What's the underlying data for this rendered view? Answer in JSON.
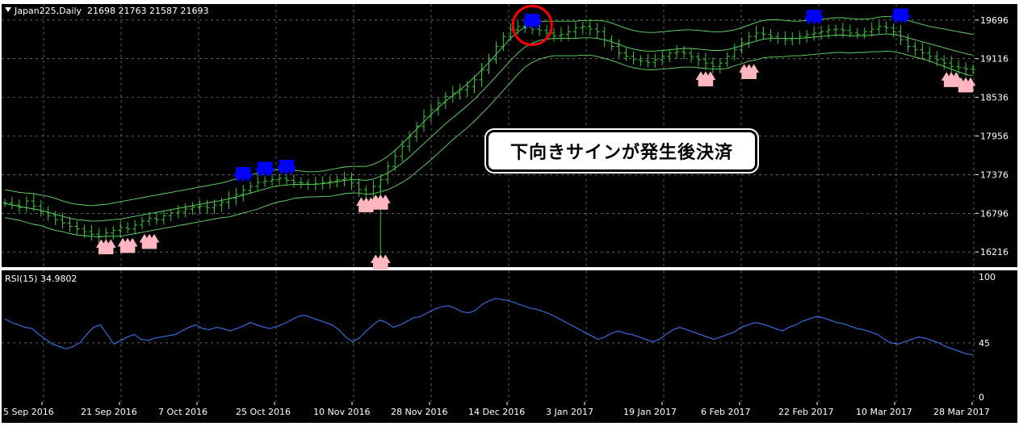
{
  "symbol_header": {
    "symbol": "Japan225,Daily",
    "ohlc": "21698 21763 21587 21693"
  },
  "rsi_header": {
    "label": "RSI(15) 34.9802"
  },
  "callout": {
    "text": "下向きサインが発生後決済"
  },
  "colors": {
    "background": "#000000",
    "grid": "#9aa3a8",
    "candles": "#33cc33",
    "bands": "#66dd66",
    "rsi_line": "#3b7bff",
    "sell_arrow": "#0000ff",
    "buy_arrow": "#ffb6c1",
    "highlight_circle": "#ff0000",
    "text": "#ffffff"
  },
  "chart_data": [
    {
      "type": "line",
      "series_kind": "ohlc-bars-with-bands",
      "price_ticks": [
        "19696",
        "19116",
        "18536",
        "17956",
        "17376",
        "16796",
        "16216"
      ],
      "x_tick_labels": [
        "5 Sep 2016",
        "21 Sep 2016",
        "7 Oct 2016",
        "25 Oct 2016",
        "10 Nov 2016",
        "28 Nov 2016",
        "14 Dec 2016",
        "3 Jan 2017",
        "19 Jan 2017",
        "6 Feb 2017",
        "22 Feb 2017",
        "10 Mar 2017",
        "28 Mar 2017"
      ],
      "ylim": [
        16000,
        19900
      ],
      "close": [
        16950,
        16920,
        16880,
        16980,
        16900,
        16820,
        16760,
        16700,
        16650,
        16600,
        16560,
        16520,
        16480,
        16450,
        16500,
        16540,
        16580,
        16560,
        16620,
        16680,
        16720,
        16700,
        16760,
        16800,
        16820,
        16860,
        16890,
        16900,
        16880,
        16920,
        16960,
        17020,
        17080,
        17140,
        17200,
        17260,
        17280,
        17300,
        17320,
        17290,
        17260,
        17250,
        17230,
        17240,
        17260,
        17280,
        17300,
        17320,
        17250,
        17150,
        17000,
        17200,
        17300,
        17500,
        17650,
        17800,
        17950,
        18100,
        18250,
        18350,
        18450,
        18550,
        18600,
        18650,
        18700,
        18800,
        18950,
        19100,
        19300,
        19450,
        19550,
        19600,
        19580,
        19560,
        19540,
        19500,
        19460,
        19480,
        19520,
        19580,
        19600,
        19560,
        19520,
        19400,
        19300,
        19200,
        19150,
        19100,
        19080,
        19060,
        19100,
        19150,
        19200,
        19220,
        19200,
        19150,
        19100,
        19050,
        19000,
        19050,
        19150,
        19250,
        19350,
        19450,
        19500,
        19480,
        19450,
        19420,
        19400,
        19420,
        19450,
        19480,
        19500,
        19520,
        19550,
        19560,
        19540,
        19500,
        19480,
        19520,
        19560,
        19600,
        19580,
        19520,
        19400,
        19300,
        19250,
        19200,
        19150,
        19100,
        19050,
        19000,
        18980,
        18960,
        18950
      ],
      "upper_band": [
        17150,
        17130,
        17110,
        17100,
        17090,
        17070,
        17050,
        17020,
        16980,
        16950,
        16930,
        16920,
        16910,
        16920,
        16930,
        16950,
        16970,
        16990,
        17010,
        17030,
        17050,
        17070,
        17090,
        17110,
        17130,
        17150,
        17170,
        17190,
        17210,
        17230,
        17250,
        17280,
        17310,
        17340,
        17370,
        17400,
        17420,
        17440,
        17450,
        17450,
        17440,
        17430,
        17420,
        17420,
        17430,
        17450,
        17470,
        17490,
        17500,
        17500,
        17500,
        17530,
        17580,
        17650,
        17740,
        17840,
        17950,
        18060,
        18170,
        18280,
        18380,
        18480,
        18560,
        18650,
        18740,
        18840,
        18950,
        19060,
        19180,
        19300,
        19420,
        19520,
        19590,
        19640,
        19670,
        19680,
        19680,
        19680,
        19680,
        19680,
        19690,
        19690,
        19690,
        19680,
        19650,
        19610,
        19570,
        19540,
        19520,
        19510,
        19510,
        19520,
        19530,
        19540,
        19550,
        19550,
        19540,
        19530,
        19520,
        19520,
        19530,
        19550,
        19580,
        19620,
        19660,
        19690,
        19700,
        19700,
        19690,
        19680,
        19680,
        19690,
        19700,
        19710,
        19720,
        19730,
        19730,
        19720,
        19710,
        19710,
        19720,
        19740,
        19750,
        19740,
        19720,
        19690,
        19660,
        19630,
        19600,
        19580,
        19560,
        19540,
        19520,
        19500,
        19480
      ],
      "middle_band": [
        16940,
        16920,
        16900,
        16880,
        16860,
        16840,
        16810,
        16780,
        16750,
        16720,
        16700,
        16690,
        16680,
        16680,
        16690,
        16700,
        16710,
        16730,
        16750,
        16770,
        16790,
        16810,
        16830,
        16850,
        16870,
        16890,
        16910,
        16930,
        16950,
        16970,
        16990,
        17010,
        17040,
        17070,
        17100,
        17130,
        17160,
        17190,
        17210,
        17220,
        17230,
        17230,
        17230,
        17230,
        17240,
        17250,
        17270,
        17290,
        17300,
        17300,
        17290,
        17310,
        17350,
        17400,
        17470,
        17550,
        17640,
        17740,
        17840,
        17940,
        18040,
        18140,
        18230,
        18320,
        18410,
        18510,
        18620,
        18730,
        18850,
        18970,
        19090,
        19200,
        19290,
        19350,
        19390,
        19410,
        19420,
        19420,
        19420,
        19420,
        19430,
        19430,
        19420,
        19400,
        19370,
        19330,
        19290,
        19260,
        19240,
        19230,
        19230,
        19240,
        19250,
        19260,
        19270,
        19270,
        19260,
        19250,
        19240,
        19240,
        19250,
        19280,
        19310,
        19350,
        19380,
        19410,
        19420,
        19420,
        19420,
        19420,
        19420,
        19430,
        19440,
        19450,
        19460,
        19470,
        19470,
        19460,
        19460,
        19460,
        19470,
        19480,
        19490,
        19480,
        19460,
        19430,
        19400,
        19370,
        19340,
        19310,
        19280,
        19250,
        19220,
        19190,
        19170
      ],
      "lower_band": [
        16730,
        16710,
        16690,
        16660,
        16630,
        16610,
        16570,
        16540,
        16520,
        16490,
        16470,
        16460,
        16450,
        16440,
        16450,
        16450,
        16450,
        16470,
        16490,
        16510,
        16530,
        16550,
        16570,
        16590,
        16610,
        16630,
        16650,
        16670,
        16690,
        16710,
        16730,
        16740,
        16770,
        16800,
        16830,
        16860,
        16900,
        16940,
        16970,
        16990,
        17020,
        17030,
        17040,
        17040,
        17050,
        17050,
        17070,
        17090,
        17100,
        17100,
        17080,
        17090,
        17120,
        17150,
        17200,
        17260,
        17330,
        17420,
        17510,
        17600,
        17700,
        17800,
        17900,
        17990,
        18080,
        18180,
        18290,
        18400,
        18520,
        18640,
        18760,
        18880,
        18990,
        19060,
        19110,
        19140,
        19160,
        19160,
        19160,
        19160,
        19170,
        19170,
        19150,
        19120,
        19090,
        19050,
        19010,
        18980,
        18960,
        18950,
        18950,
        18960,
        18970,
        18980,
        18990,
        18990,
        18980,
        18970,
        18960,
        18960,
        18970,
        19010,
        19040,
        19080,
        19100,
        19130,
        19140,
        19140,
        19150,
        19160,
        19160,
        19170,
        19180,
        19190,
        19200,
        19210,
        19210,
        19200,
        19210,
        19210,
        19220,
        19220,
        19230,
        19220,
        19200,
        19170,
        19140,
        19110,
        19080,
        19040,
        19000,
        18960,
        18920,
        18880,
        18860
      ],
      "sell_arrows_index": [
        33,
        36,
        39,
        73,
        112,
        124
      ],
      "buy_arrows_index": [
        14,
        17,
        20,
        50,
        52,
        97,
        103,
        131,
        133
      ],
      "highlight_circle_index": 73
    },
    {
      "type": "line",
      "title": "RSI(15) 34.9802",
      "ylim": [
        0,
        100
      ],
      "y_tick_labels": [
        "100",
        "45",
        "0"
      ],
      "x_tick_labels": [
        "5 Sep 2016",
        "21 Sep 2016",
        "7 Oct 2016",
        "25 Oct 2016",
        "10 Nov 2016",
        "28 Nov 2016",
        "14 Dec 2016",
        "3 Jan 2017",
        "19 Jan 2017",
        "6 Feb 2017",
        "22 Feb 2017",
        "10 Mar 2017",
        "28 Mar 2017"
      ],
      "values": [
        65,
        62,
        60,
        58,
        57,
        52,
        48,
        44,
        42,
        40,
        42,
        45,
        52,
        58,
        60,
        52,
        44,
        47,
        50,
        52,
        48,
        47,
        49,
        50,
        51,
        52,
        55,
        58,
        60,
        57,
        56,
        58,
        57,
        55,
        57,
        59,
        62,
        60,
        58,
        57,
        59,
        61,
        64,
        67,
        68,
        66,
        64,
        62,
        60,
        56,
        50,
        46,
        49,
        55,
        60,
        64,
        62,
        58,
        60,
        63,
        66,
        67,
        70,
        73,
        75,
        76,
        74,
        71,
        70,
        72,
        77,
        80,
        82,
        81,
        80,
        78,
        76,
        74,
        73,
        71,
        69,
        66,
        63,
        60,
        57,
        54,
        51,
        48,
        50,
        53,
        55,
        53,
        52,
        50,
        48,
        46,
        48,
        52,
        56,
        58,
        56,
        54,
        52,
        50,
        48,
        50,
        52,
        54,
        58,
        60,
        62,
        61,
        59,
        57,
        55,
        58,
        60,
        63,
        65,
        67,
        66,
        64,
        62,
        61,
        59,
        57,
        56,
        54,
        52,
        48,
        45,
        44,
        46,
        48,
        50,
        49,
        47,
        45,
        42,
        40,
        38,
        36,
        35
      ]
    }
  ]
}
